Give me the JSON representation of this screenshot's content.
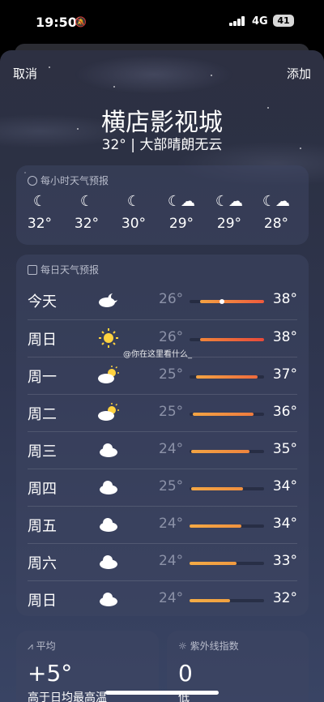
{
  "status_bar": {
    "time": "19:50",
    "network": "4G",
    "battery": "41"
  },
  "header": {
    "cancel_label": "取消",
    "add_label": "添加"
  },
  "location": {
    "city": "横店影视城",
    "summary": "32° | 大部晴朗无云"
  },
  "hourly": {
    "title": "每小时天气预报",
    "items": [
      {
        "icon": "moon-icon",
        "temp": "32°"
      },
      {
        "icon": "moon-icon",
        "temp": "32°"
      },
      {
        "icon": "moon-icon",
        "temp": "30°"
      },
      {
        "icon": "moon-cloud-icon",
        "temp": "29°"
      },
      {
        "icon": "moon-cloud-icon",
        "temp": "29°"
      },
      {
        "icon": "moon-cloud-icon",
        "temp": "28°"
      }
    ]
  },
  "daily": {
    "title": "每日天气预报",
    "items": [
      {
        "day": "今天",
        "icon": "moon-cloud-icon",
        "low": "26°",
        "high": "38°"
      },
      {
        "day": "周日",
        "icon": "sun-icon",
        "low": "26°",
        "high": "38°"
      },
      {
        "day": "周一",
        "icon": "sun-cloud-icon",
        "low": "25°",
        "high": "37°"
      },
      {
        "day": "周二",
        "icon": "sun-cloud-icon",
        "low": "25°",
        "high": "36°"
      },
      {
        "day": "周三",
        "icon": "cloud-icon",
        "low": "24°",
        "high": "35°"
      },
      {
        "day": "周四",
        "icon": "cloud-icon",
        "low": "25°",
        "high": "34°"
      },
      {
        "day": "周五",
        "icon": "cloud-icon",
        "low": "24°",
        "high": "34°"
      },
      {
        "day": "周六",
        "icon": "cloud-icon",
        "low": "24°",
        "high": "33°"
      },
      {
        "day": "周日",
        "icon": "cloud-icon",
        "low": "24°",
        "high": "32°"
      }
    ]
  },
  "average": {
    "title": "平均",
    "value": "+5°",
    "subtitle": "高于日均最高温"
  },
  "uv": {
    "title": "紫外线指数",
    "value": "0",
    "subtitle": "低"
  },
  "watermark": "@你在这里看什么_"
}
